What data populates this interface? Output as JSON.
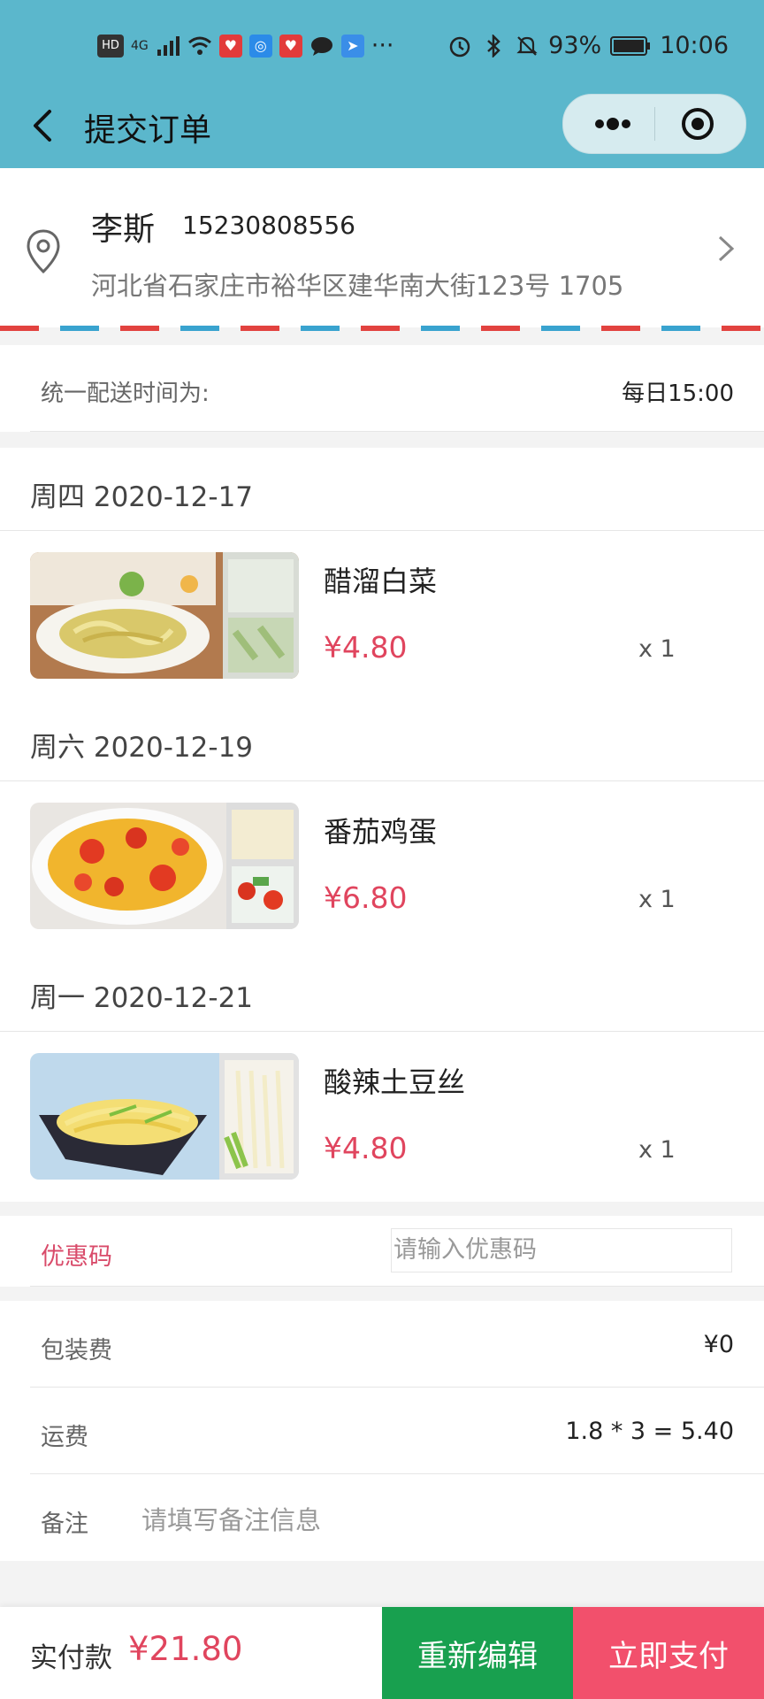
{
  "status_bar": {
    "hd": "HD",
    "network": "4G",
    "more": "···",
    "battery": "93%",
    "time": "10:06"
  },
  "nav": {
    "title": "提交订单"
  },
  "address": {
    "name": "李斯",
    "phone": "15230808556",
    "detail": "河北省石家庄市裕华区建华南大街123号 1705"
  },
  "delivery": {
    "label": "统一配送时间为:",
    "value": "每日15:00"
  },
  "orders": [
    {
      "date": "周四 2020-12-17",
      "name": "醋溜白菜",
      "price": "¥4.80",
      "qty": "x 1"
    },
    {
      "date": "周六 2020-12-19",
      "name": "番茄鸡蛋",
      "price": "¥6.80",
      "qty": "x 1"
    },
    {
      "date": "周一 2020-12-21",
      "name": "酸辣土豆丝",
      "price": "¥4.80",
      "qty": "x 1"
    }
  ],
  "coupon": {
    "label": "优惠码",
    "placeholder": "请输入优惠码"
  },
  "fees": {
    "packing_label": "包装费",
    "packing_value": "¥0",
    "shipping_label": "运费",
    "shipping_value": "1.8 * 3 = 5.40",
    "remark_label": "备注",
    "remark_placeholder": "请填写备注信息"
  },
  "bottom": {
    "pay_label": "实付款",
    "pay_amount": "¥21.80",
    "edit_button": "重新编辑",
    "pay_button": "立即支付"
  },
  "colors": {
    "header": "#5bb7cc",
    "price": "#e0455e",
    "edit_button": "#18a04f",
    "pay_button": "#f2506c"
  }
}
